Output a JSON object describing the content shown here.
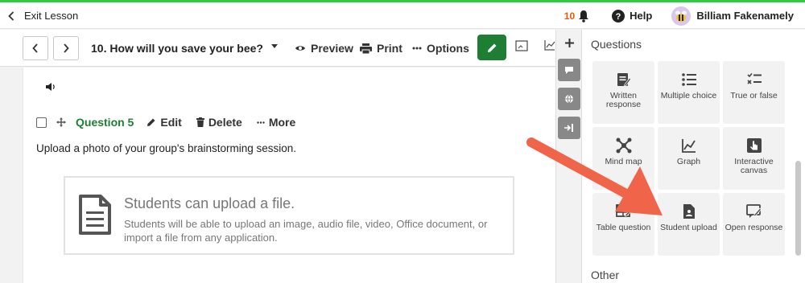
{
  "topbar": {
    "exit_label": "Exit Lesson",
    "notification_count": "10",
    "help_label": "Help",
    "user_name": "Billiam Fakenamely"
  },
  "toolbar": {
    "lesson_title": "10. How will you save your bee?",
    "preview_label": "Preview",
    "print_label": "Print",
    "options_label": "Options"
  },
  "question": {
    "label": "Question 5",
    "edit_label": "Edit",
    "delete_label": "Delete",
    "more_label": "More",
    "prompt": "Upload a photo of your group's brainstorming session.",
    "upload_title": "Students can upload a file.",
    "upload_desc": "Students will be able to upload an image, audio file, video, Office document, or import a file from any application."
  },
  "panel": {
    "section_title": "Questions",
    "other_title": "Other",
    "tiles": [
      {
        "label": "Written response",
        "icon": "written-response-icon"
      },
      {
        "label": "Multiple choice",
        "icon": "multiple-choice-icon"
      },
      {
        "label": "True or false",
        "icon": "true-false-icon"
      },
      {
        "label": "Mind map",
        "icon": "mind-map-icon"
      },
      {
        "label": "Graph",
        "icon": "graph-icon"
      },
      {
        "label": "Interactive canvas",
        "icon": "interactive-canvas-icon"
      },
      {
        "label": "Table question",
        "icon": "table-icon"
      },
      {
        "label": "Student upload",
        "icon": "student-upload-icon"
      },
      {
        "label": "Open response",
        "icon": "open-response-icon"
      }
    ]
  },
  "colors": {
    "accent_green": "#1e7e34",
    "top_stripe": "#2ecc40",
    "notification": "#e8590c",
    "annotation_arrow": "#f0644a"
  }
}
